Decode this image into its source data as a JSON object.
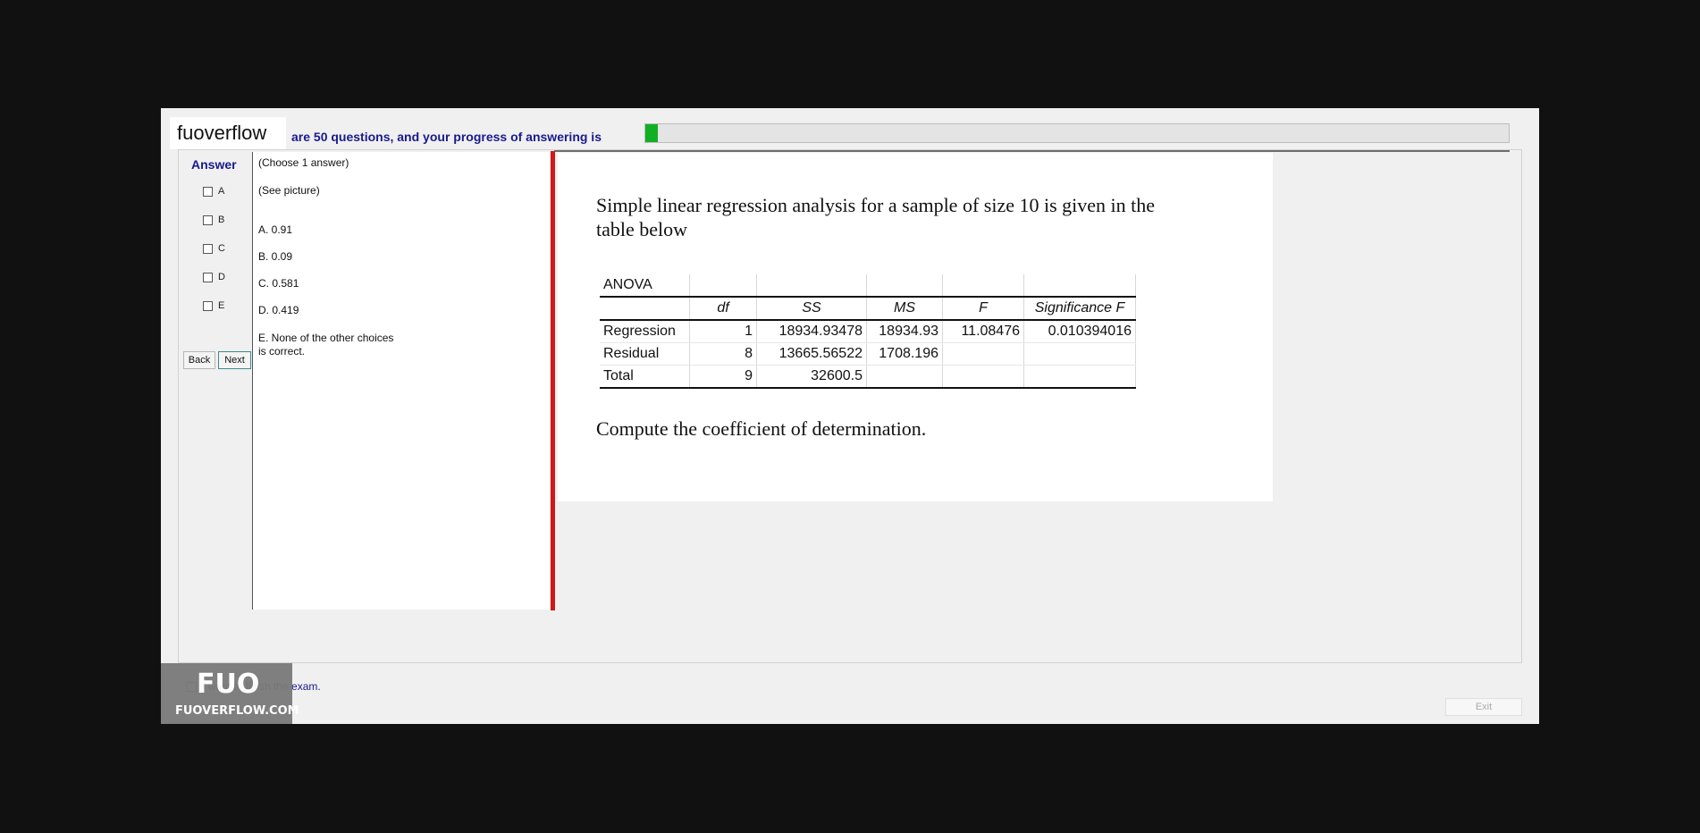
{
  "brand": "fuoverflow",
  "progress": {
    "text": "are 50 questions, and your progress of answering is",
    "value_percent": 1.5,
    "color": "#11b023"
  },
  "answer": {
    "heading": "Answer",
    "options": [
      "A",
      "B",
      "C",
      "D",
      "E"
    ]
  },
  "nav": {
    "back": "Back",
    "next": "Next"
  },
  "question": {
    "instruction": "(Choose 1 answer)",
    "see_picture": "(See picture)",
    "choices": [
      "A.  0.91",
      "B.  0.09",
      "C.  0.581",
      "D.  0.419"
    ],
    "choice_e_line1": "E.  None of the other choices",
    "choice_e_line2": "is correct."
  },
  "picture": {
    "intro_line1": "Simple linear regression analysis for a sample of size 10 is given in the",
    "intro_line2": "table below",
    "table_title": "ANOVA",
    "headers": [
      "df",
      "SS",
      "MS",
      "F",
      "Significance F"
    ],
    "rows": [
      [
        "Regression",
        "1",
        "18934.93478",
        "18934.93",
        "11.08476",
        "0.010394016"
      ],
      [
        "Residual",
        "8",
        "13665.56522",
        "1708.196",
        "",
        ""
      ],
      [
        "Total",
        "9",
        "32600.5",
        "",
        "",
        ""
      ]
    ],
    "prompt": "Compute the coefficient of determination."
  },
  "finish": {
    "label": "I want to finish the exam."
  },
  "watermark": {
    "logo": "FUO",
    "site": "FUOVERFLOW.COM"
  },
  "exit": "Exit"
}
